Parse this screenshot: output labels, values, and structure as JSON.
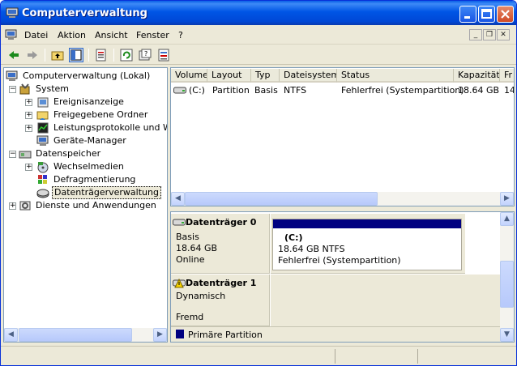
{
  "window": {
    "title": "Computerverwaltung"
  },
  "menu": [
    "Datei",
    "Aktion",
    "Ansicht",
    "Fenster",
    "?"
  ],
  "tree": {
    "root": "Computerverwaltung (Lokal)",
    "system": "System",
    "system_children": [
      "Ereignisanzeige",
      "Freigegebene Ordner",
      "Leistungsprotokolle und Warn",
      "Geräte-Manager"
    ],
    "storage": "Datenspeicher",
    "storage_children": [
      "Wechselmedien",
      "Defragmentierung",
      "Datenträgerverwaltung"
    ],
    "services": "Dienste und Anwendungen"
  },
  "volume_table": {
    "columns": [
      "Volume",
      "Layout",
      "Typ",
      "Dateisystem",
      "Status",
      "Kapazität",
      "Fr"
    ],
    "rows": [
      {
        "volume": "(C:)",
        "layout": "Partition",
        "type": "Basis",
        "filesystem": "NTFS",
        "status": "Fehlerfrei (Systempartition)",
        "capacity": "18.64 GB",
        "free": "14"
      }
    ]
  },
  "disks": [
    {
      "name": "Datenträger 0",
      "type": "Basis",
      "size": "18.64 GB",
      "state": "Online",
      "partition": {
        "label": "(C:)",
        "size_fs": "18.64 GB NTFS",
        "status": "Fehlerfrei (Systempartition)"
      }
    },
    {
      "name": "Datenträger 1",
      "type": "Dynamisch",
      "state": "Fremd"
    }
  ],
  "legend": {
    "label": "Primäre Partition",
    "color": "#000080"
  },
  "colors": {
    "partition_bar": "#000080",
    "title_bar": "#0055e5"
  }
}
